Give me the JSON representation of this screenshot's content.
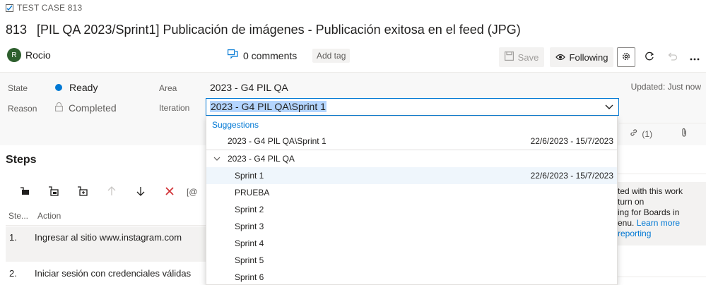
{
  "header": {
    "type_label": "TEST CASE 813",
    "id": "813",
    "title": "[PIL QA 2023/Sprint1] Publicación de imágenes - Publicación exitosa en el feed (JPG)",
    "assignee_initial": "R",
    "assignee_name": "Rocio",
    "comments_label": "0 comments",
    "add_tag_label": "Add tag",
    "save_label": "Save",
    "following_label": "Following"
  },
  "fields": {
    "state_label": "State",
    "state_value": "Ready",
    "state_color": "#0078d4",
    "reason_label": "Reason",
    "reason_value": "Completed",
    "area_label": "Area",
    "area_value": "2023 - G4 PIL QA",
    "iteration_label": "Iteration",
    "iteration_value": "2023 - G4 PIL QA\\Sprint 1",
    "updated_text": "Updated: Just now"
  },
  "right_tabs": {
    "links_count": "(1)"
  },
  "steps": {
    "title": "Steps",
    "col_step": "Ste...",
    "col_action": "Action",
    "toolbar_partial": "[@",
    "rows": [
      {
        "num": "1.",
        "text": "Ingresar al sitio www.instagram.com"
      },
      {
        "num": "2.",
        "text": "Iniciar sesión con credenciales válidas"
      }
    ]
  },
  "info_box": {
    "line1": "ted with this work",
    "line2": "turn on",
    "line3": "ing for Boards in",
    "line4_text": "enu.",
    "line4_link": "Learn more",
    "line5_link": "reporting"
  },
  "dropdown": {
    "suggestions_header": "Suggestions",
    "suggestion_item": {
      "label": "2023 - G4 PIL QA\\Sprint 1",
      "range": "22/6/2023 - 15/7/2023"
    },
    "group_label": "2023 - G4 PIL QA",
    "items": [
      {
        "label": "Sprint 1",
        "range": "22/6/2023 - 15/7/2023"
      },
      {
        "label": "PRUEBA",
        "range": ""
      },
      {
        "label": "Sprint 2",
        "range": ""
      },
      {
        "label": "Sprint 3",
        "range": ""
      },
      {
        "label": "Sprint 4",
        "range": ""
      },
      {
        "label": "Sprint 5",
        "range": ""
      },
      {
        "label": "Sprint 6",
        "range": ""
      }
    ]
  }
}
